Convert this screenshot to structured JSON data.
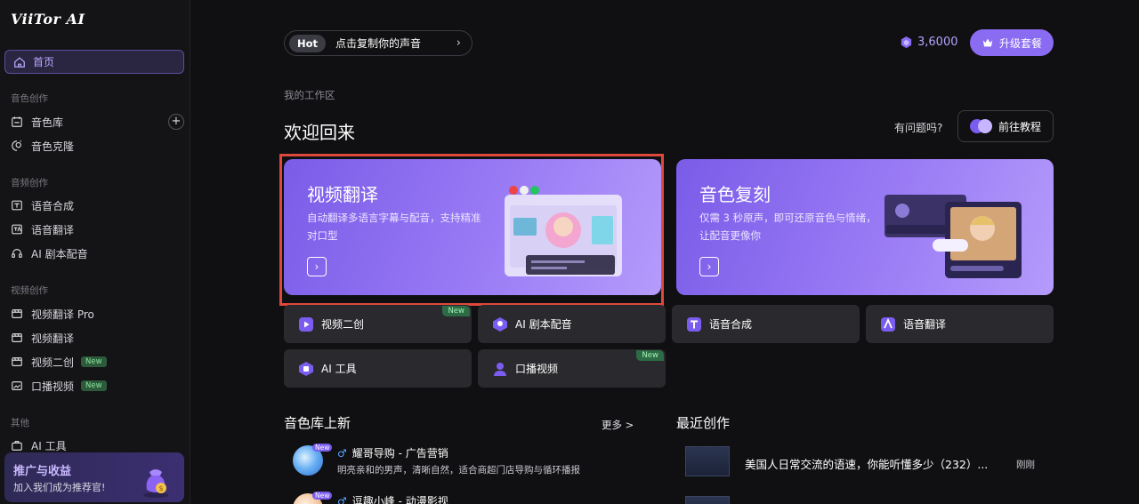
{
  "app": {
    "logo_text": "ViiTor AI"
  },
  "sidebar": {
    "home": "首页",
    "sections": [
      {
        "title": "音色创作",
        "items": [
          {
            "label": "音色库",
            "icon": "voice-library-icon",
            "has_add": true
          },
          {
            "label": "音色克隆",
            "icon": "voice-clone-icon"
          }
        ]
      },
      {
        "title": "音频创作",
        "items": [
          {
            "label": "语音合成",
            "icon": "speech-synthesis-icon"
          },
          {
            "label": "语音翻译",
            "icon": "speech-translate-icon"
          },
          {
            "label": "AI 剧本配音",
            "icon": "script-dubbing-icon"
          }
        ]
      },
      {
        "title": "视频创作",
        "items": [
          {
            "label": "视频翻译 Pro",
            "icon": "video-translate-pro-icon"
          },
          {
            "label": "视频翻译",
            "icon": "video-translate-icon"
          },
          {
            "label": "视频二创",
            "icon": "video-remix-icon",
            "badge": "New"
          },
          {
            "label": "口播视频",
            "icon": "talking-video-icon",
            "badge": "New"
          }
        ]
      },
      {
        "title": "其他",
        "items": [
          {
            "label": "AI 工具",
            "icon": "ai-tools-icon"
          }
        ]
      }
    ],
    "promo": {
      "title": "推广与收益",
      "subtitle": "加入我们成为推荐官!"
    }
  },
  "header": {
    "hot_tag": "Hot",
    "hot_text": "点击复制你的声音",
    "credits": "3,6000",
    "upgrade_label": "升级套餐"
  },
  "workspace": {
    "label": "我的工作区",
    "welcome": "欢迎回来",
    "question": "有问题吗?",
    "tutorial_label": "前往教程"
  },
  "features": [
    {
      "title": "视频翻译",
      "desc": "自动翻译多语言字幕与配音，支持精准对口型"
    },
    {
      "title": "音色复刻",
      "desc": "仅需 3 秒原声，即可还原音色与情绪，让配音更像你"
    }
  ],
  "tools": [
    {
      "label": "视频二创",
      "badge": "New"
    },
    {
      "label": "AI 剧本配音"
    },
    {
      "label": "语音合成"
    },
    {
      "label": "语音翻译"
    },
    {
      "label": "AI 工具"
    },
    {
      "label": "口播视频",
      "badge": "New"
    }
  ],
  "voice_library": {
    "title": "音色库上新",
    "more": "更多 >",
    "items": [
      {
        "name": "耀哥导购 - 广告营销",
        "desc": "明亮亲和的男声，清晰自然，适合商超门店导购与循环播报",
        "badge": "New"
      },
      {
        "name": "逗趣小峰 - 动漫影视",
        "desc": "",
        "badge": "New"
      }
    ]
  },
  "recent": {
    "title": "最近创作",
    "items": [
      {
        "title": "美国人日常交流的语速，你能听懂多少（232）...",
        "time": "刚刚"
      }
    ]
  },
  "colors": {
    "accent": "#8a6cf3",
    "highlight": "#e0483c",
    "background": "#101012"
  }
}
